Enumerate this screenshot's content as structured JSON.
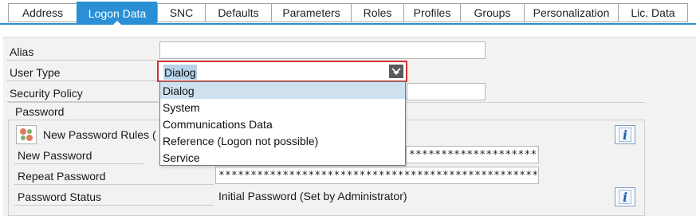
{
  "tabs": [
    {
      "label": "Address",
      "active": false
    },
    {
      "label": "Logon Data",
      "active": true
    },
    {
      "label": "SNC",
      "active": false
    },
    {
      "label": "Defaults",
      "active": false
    },
    {
      "label": "Parameters",
      "active": false
    },
    {
      "label": "Roles",
      "active": false
    },
    {
      "label": "Profiles",
      "active": false
    },
    {
      "label": "Groups",
      "active": false
    },
    {
      "label": "Personalization",
      "active": false
    },
    {
      "label": "Lic. Data",
      "active": false
    }
  ],
  "form": {
    "alias_label": "Alias",
    "alias_value": "",
    "user_type_label": "User Type",
    "user_type_value": "Dialog",
    "security_policy_label": "Security Policy",
    "security_policy_value": ""
  },
  "dropdown": {
    "options": [
      "Dialog",
      "System",
      "Communications Data",
      "Reference (Logon not possible)",
      "Service"
    ],
    "selected_index": 0
  },
  "password_group": {
    "title": "Password",
    "rules_label": "New Password Rules (",
    "new_password_label": "New Password",
    "new_password_value": "****************************",
    "repeat_password_label": "Repeat Password",
    "repeat_password_value": "***************************************************",
    "status_label": "Password Status",
    "status_value": "Initial Password (Set by Administrator)",
    "info_glyph": "i"
  },
  "colors": {
    "accent": "#2a8fd5",
    "focus_border": "#d32f2f",
    "selection": "#b9d4ea"
  }
}
